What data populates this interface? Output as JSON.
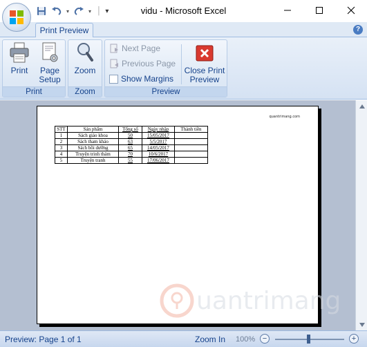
{
  "window": {
    "title": "vidu - Microsoft Excel",
    "qat_separator": "│",
    "qat_more": "▾"
  },
  "tabs": {
    "active": "Print Preview",
    "help": "?"
  },
  "ribbon": {
    "print_group": {
      "label": "Print",
      "print_label": "Print",
      "page_setup_line1": "Page",
      "page_setup_line2": "Setup"
    },
    "zoom_group": {
      "label": "Zoom",
      "zoom_label": "Zoom"
    },
    "preview_group": {
      "label": "Preview",
      "next_page": "Next Page",
      "previous_page": "Previous Page",
      "show_margins": "Show Margins",
      "close_line1": "Close Print",
      "close_line2": "Preview"
    }
  },
  "page": {
    "header_right": "quantrimang.com",
    "columns": [
      "STT",
      "Sản phẩm",
      "Tổng số",
      "Ngày nhập",
      "Thành tiền"
    ],
    "rows": [
      [
        "1",
        "Sách giáo khoa",
        "50",
        "15/05/2017",
        ""
      ],
      [
        "2",
        "Sách tham khảo",
        "63",
        "5/5/2017",
        ""
      ],
      [
        "3",
        "Sách bồi dưỡng",
        "65",
        "14/05/2017",
        ""
      ],
      [
        "4",
        "Truyện trinh thám",
        "70",
        "10/6/2017",
        ""
      ],
      [
        "5",
        "Truyện tranh",
        "55",
        "17/06/2017",
        ""
      ]
    ]
  },
  "status": {
    "page_info": "Preview: Page 1 of 1",
    "zoom_in": "Zoom In",
    "zoom_percent": "100%",
    "minus": "−",
    "plus": "+"
  },
  "colors": {
    "ribbon_text": "#15428b",
    "close_red": "#d9392f",
    "preview_bg": "#b4bfd1"
  }
}
